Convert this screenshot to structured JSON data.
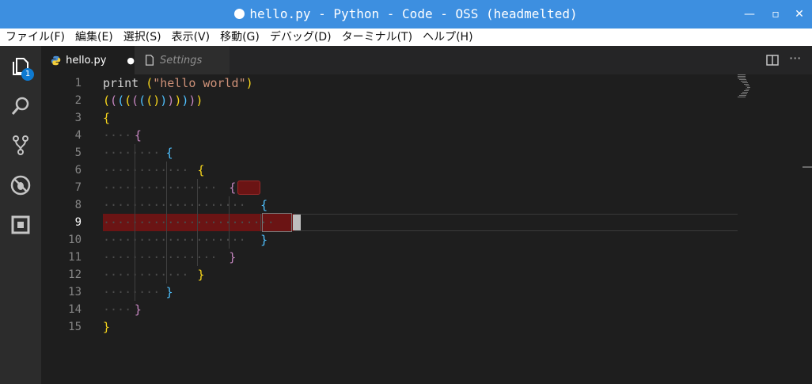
{
  "window": {
    "title": "hello.py - Python - Code - OSS (headmelted)"
  },
  "menu": [
    "ファイル(F)",
    "編集(E)",
    "選択(S)",
    "表示(V)",
    "移動(G)",
    "デバッグ(D)",
    "ターミナル(T)",
    "ヘルプ(H)"
  ],
  "activity": {
    "explorer_badge": "1",
    "icons": [
      "files-icon",
      "search-icon",
      "source-control-icon",
      "debug-icon",
      "extensions-icon"
    ]
  },
  "tabs": [
    {
      "label": "hello.py",
      "modified": true,
      "active": true
    },
    {
      "label": "Settings",
      "modified": false,
      "active": false
    }
  ],
  "editor": {
    "active_line": 9,
    "line_numbers": [
      "1",
      "2",
      "3",
      "4",
      "5",
      "6",
      "7",
      "8",
      "9",
      "10",
      "11",
      "12",
      "13",
      "14",
      "15"
    ],
    "lines": [
      [
        {
          "t": "print ",
          "c": "#d4d4d4"
        },
        {
          "t": "(",
          "c": "#f9d71c"
        },
        {
          "t": "\"hello world\"",
          "c": "#ce9178"
        },
        {
          "t": ")",
          "c": "#f9d71c"
        }
      ],
      [
        {
          "t": "(",
          "c": "#f9d71c"
        },
        {
          "t": "(",
          "c": "#c586c0"
        },
        {
          "t": "(",
          "c": "#4fc1ff"
        },
        {
          "t": "(",
          "c": "#f9d71c"
        },
        {
          "t": "(",
          "c": "#c586c0"
        },
        {
          "t": "(",
          "c": "#4fc1ff"
        },
        {
          "t": "(",
          "c": "#f9d71c"
        },
        {
          "t": ")",
          "c": "#f9d71c"
        },
        {
          "t": ")",
          "c": "#4fc1ff"
        },
        {
          "t": ")",
          "c": "#c586c0"
        },
        {
          "t": ")",
          "c": "#f9d71c"
        },
        {
          "t": ")",
          "c": "#4fc1ff"
        },
        {
          "t": ")",
          "c": "#c586c0"
        },
        {
          "t": ")",
          "c": "#f9d71c"
        }
      ],
      [
        {
          "t": "{",
          "c": "#f9d71c"
        }
      ],
      [
        {
          "t": "{",
          "c": "#c586c0"
        }
      ],
      [
        {
          "t": "{",
          "c": "#4fc1ff"
        }
      ],
      [
        {
          "t": "{",
          "c": "#f9d71c"
        }
      ],
      [
        {
          "t": "{",
          "c": "#c586c0"
        }
      ],
      [
        {
          "t": "{",
          "c": "#4fc1ff"
        }
      ],
      [],
      [
        {
          "t": "}",
          "c": "#4fc1ff"
        }
      ],
      [
        {
          "t": "}",
          "c": "#c586c0"
        }
      ],
      [
        {
          "t": "}",
          "c": "#f9d71c"
        }
      ],
      [
        {
          "t": "}",
          "c": "#4fc1ff"
        }
      ],
      [
        {
          "t": "}",
          "c": "#c586c0"
        }
      ],
      [
        {
          "t": "}",
          "c": "#f9d71c"
        }
      ]
    ],
    "indent_levels": [
      0,
      0,
      0,
      1,
      2,
      3,
      4,
      5,
      6,
      5,
      4,
      3,
      2,
      1,
      0
    ]
  }
}
